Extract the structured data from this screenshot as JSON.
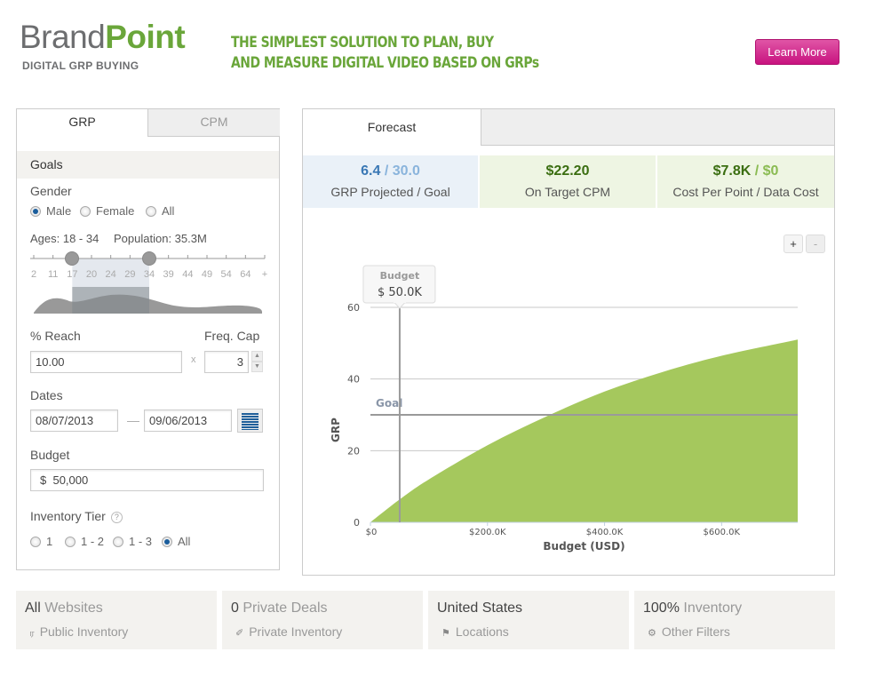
{
  "header": {
    "logo_brand": "Brand",
    "logo_point": "Point",
    "logo_subtitle": "DIGITAL GRP BUYING",
    "tagline_line1": "THE SIMPLEST SOLUTION TO PLAN, BUY",
    "tagline_line2": "AND MEASURE DIGITAL VIDEO BASED ON GRPs",
    "learn_more": "Learn More"
  },
  "left_panel": {
    "tabs": [
      {
        "label": "GRP",
        "active": true
      },
      {
        "label": "CPM",
        "active": false
      }
    ],
    "section_title": "Goals",
    "gender_label": "Gender",
    "gender_options": [
      {
        "label": "Male",
        "selected": true
      },
      {
        "label": "Female",
        "selected": false
      },
      {
        "label": "All",
        "selected": false
      }
    ],
    "ages_text": "Ages: 18 - 34",
    "population_text": "Population: 35.3M",
    "age_ticks": [
      "2",
      "11",
      "17",
      "20",
      "24",
      "29",
      "34",
      "39",
      "44",
      "49",
      "54",
      "64",
      "+"
    ],
    "age_range_index": [
      2,
      6
    ],
    "reach_label": "% Reach",
    "reach_value": "10.00",
    "times_sign": "x",
    "freq_cap_label": "Freq. Cap",
    "freq_cap_value": "3",
    "dates_label": "Dates",
    "date_start": "08/07/2013",
    "date_separator": "—",
    "date_end": "09/06/2013",
    "budget_label": "Budget",
    "budget_currency": "$",
    "budget_value": "50,000",
    "inventory_tier_label": "Inventory Tier",
    "help_icon": "?",
    "tier_options": [
      {
        "label": "1",
        "selected": false
      },
      {
        "label": "1 - 2",
        "selected": false
      },
      {
        "label": "1 - 3",
        "selected": false
      },
      {
        "label": "All",
        "selected": true
      }
    ]
  },
  "forecast": {
    "tab_label": "Forecast",
    "metrics": [
      {
        "value": "6.4",
        "value2": "30.0",
        "caption": "GRP Projected / Goal",
        "color": "#3a78b5",
        "color2": "#8ab4dc",
        "bg": "#eaf1f8"
      },
      {
        "value": "$22.20",
        "value2": "",
        "caption": "On Target CPM",
        "color": "#3b6e11",
        "color2": "",
        "bg": "#eef5e3"
      },
      {
        "value": "$7.8K",
        "value2": "$0",
        "caption": "Cost Per Point / Data Cost",
        "color": "#3b6e11",
        "color2": "#8abb52",
        "bg": "#eef5e3"
      }
    ],
    "zoom_in": "+",
    "zoom_out": "-"
  },
  "chart_data": {
    "type": "area",
    "title": "",
    "xlabel": "Budget (USD)",
    "ylabel": "GRP",
    "x_ticks": [
      "$0",
      "$200.0K",
      "$400.0K",
      "$600.0K"
    ],
    "x_tick_values": [
      0,
      200000,
      400000,
      600000
    ],
    "y_ticks": [
      "0",
      "20",
      "40",
      "60"
    ],
    "y_tick_values": [
      0,
      20,
      40,
      60
    ],
    "xlim": [
      0,
      730000
    ],
    "ylim": [
      0,
      60
    ],
    "grid": true,
    "series": [
      {
        "name": "GRP Projected",
        "color": "#a5c85d",
        "x": [
          0,
          50000,
          100000,
          200000,
          300000,
          400000,
          500000,
          600000,
          730000
        ],
        "y": [
          0,
          6.4,
          12,
          21.5,
          29.5,
          36.5,
          42,
          46.5,
          51
        ]
      }
    ],
    "goal_line": {
      "label": "Goal",
      "value": 30
    },
    "budget_marker": {
      "label": "Budget",
      "value": 50000,
      "display": "$ 50.0K"
    }
  },
  "bottom_cards": [
    {
      "strong": "All",
      "rest": " Websites",
      "icon": "rss-icon",
      "glyph": "ர",
      "sub": "Public Inventory"
    },
    {
      "strong": "0",
      "rest": " Private Deals",
      "icon": "key-icon",
      "glyph": "✐",
      "sub": "Private Inventory"
    },
    {
      "strong": "United States",
      "rest": "",
      "icon": "flag-icon",
      "glyph": "⚑",
      "sub": "Locations"
    },
    {
      "strong": "100%",
      "rest": " Inventory",
      "icon": "gear-icon",
      "glyph": "⚙",
      "sub": "Other Filters"
    }
  ]
}
